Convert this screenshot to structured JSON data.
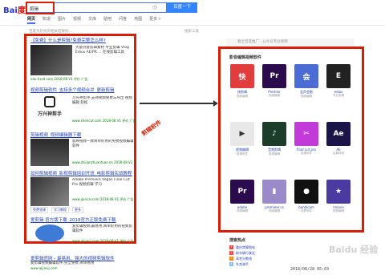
{
  "header": {
    "logo_a": "Bai",
    "logo_b": "度",
    "search_value": "剪辑",
    "search_button": "百度一下",
    "tabs": [
      "网页",
      "知道",
      "图片",
      "视频",
      "文库",
      "贴吧",
      "问答",
      "地图",
      "更多 »"
    ],
    "result_count": "百度为您找到相关结果约...",
    "search_tools": "搜索工具"
  },
  "results": [
    {
      "title": "【免费】什么是剪辑?免费完整怎么样?",
      "snippet": "大量创意剪辑素材 专业剪辑 Vlog Edius AE/PR ... 在线剪辑工具",
      "url": "edu.hxsd.com  2018-08  V1 评价 广告"
    },
    {
      "title": "视频剪辑软件_支持多个视频合并_更新剪辑",
      "snippet": "万兴神剪手,支持视频免费与导出 视频编辑 轻松",
      "url": "www.shencut.com  2018-08  V1 评价 广告",
      "brand": "万兴神剪手"
    },
    {
      "title": "剪辑视频_视频编辑器下载",
      "snippet": "剪映视频一款简单好用的免费视频编辑软件",
      "url": "www.zhijianzhuanfuan.cn  2018-08  V1 评价 广告"
    },
    {
      "title": "如何剪辑视频_影视剪辑培训开班_电影剪辑实战教程",
      "snippet": "Adobe Premiere Vegas Final Cut Pro 视频剪辑 学习",
      "url": "www.ipincai.com  2018-08  V1 评价 广告",
      "links": [
        "免费领课",
        "学习教程",
        "更多"
      ]
    },
    {
      "title": "爱剪辑 官方版下载_2018官方正版免费下载",
      "snippet": "爱剪辑视频,最易用,简单好用的视频剪辑软件",
      "url": "www.aijianji.com  2018-08  V1 评价 广告"
    },
    {
      "title": "爱剪辑官网 - 最易用、强大的视频剪辑软件",
      "snippet": "爱剪辑视频编辑软件,完全免费,简单易用",
      "url": "www.aijianji.com"
    }
  ],
  "side": {
    "banner": "看全百度推广 · 公众号专业保障",
    "panel_title": "影音编辑视频软件",
    "apps": [
      {
        "name": "快剪辑",
        "sub": "视频编辑",
        "color": "#e23c3c",
        "glyph": "快"
      },
      {
        "name": "Premier",
        "sub": "视频编辑",
        "color": "#2b0a4d",
        "glyph": "Pr"
      },
      {
        "name": "会声会影",
        "sub": "视频编辑",
        "color": "#4a6cd4",
        "glyph": "会"
      },
      {
        "name": "edius",
        "sub": "专业剪辑",
        "color": "#222222",
        "glyph": "E"
      },
      {
        "name": "视频编辑",
        "sub": "剪辑软件",
        "color": "#e8e8e8",
        "glyph": "▶"
      },
      {
        "name": "音频剪辑",
        "sub": "音频编辑",
        "color": "#1c3d2a",
        "glyph": "♪"
      },
      {
        "name": "final cut pro",
        "sub": "剪辑软件",
        "color": "#c23ad8",
        "glyph": "✂"
      },
      {
        "name": "AE",
        "sub": "后期特效",
        "color": "#1a1448",
        "glyph": "Ae"
      },
      {
        "name": "adobe",
        "sub": "视频编辑",
        "color": "#2b0a4d",
        "glyph": "Pr"
      },
      {
        "name": "premiere cs",
        "sub": "视频编辑",
        "color": "#9b8ac9",
        "glyph": "▮"
      },
      {
        "name": "bandicam",
        "sub": "录屏软件",
        "color": "#111111",
        "glyph": "●"
      },
      {
        "name": "imovie",
        "sub": "视频编辑",
        "color": "#4b3aa0",
        "glyph": "★"
      }
    ],
    "hot_title": "搜索热点",
    "hot_items": [
      "重庆禁摩限电",
      "取车辆行驶证",
      "高考分数线",
      "外卖骑手"
    ]
  },
  "annotation": "剪辑软件",
  "watermark": "Baidu 经验",
  "timestamp": "2018/08/28 05:03"
}
